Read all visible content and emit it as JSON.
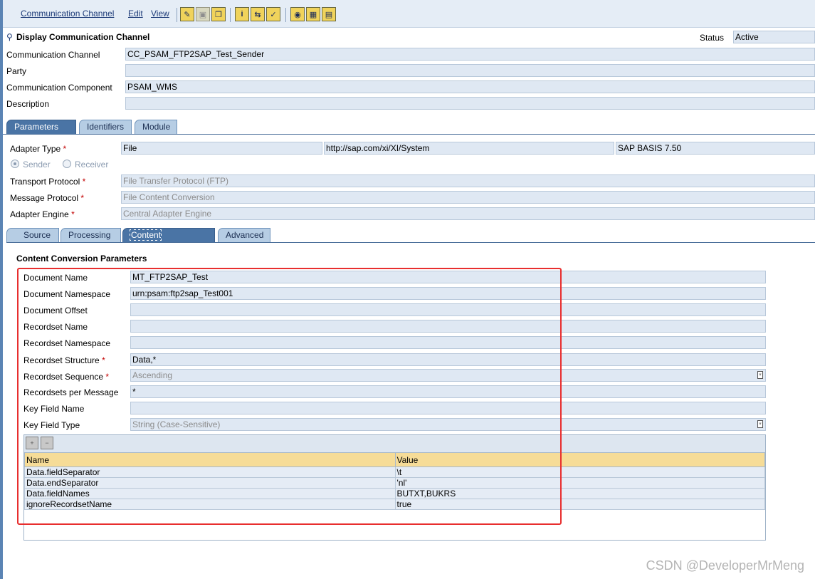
{
  "menu": {
    "items": [
      "Communication Channel",
      "Edit",
      "View"
    ]
  },
  "header": {
    "title": "Display Communication Channel",
    "status_label": "Status",
    "status_value": "Active"
  },
  "channel": {
    "fields": [
      {
        "label": "Communication Channel",
        "value": "CC_PSAM_FTP2SAP_Test_Sender"
      },
      {
        "label": "Party",
        "value": ""
      },
      {
        "label": "Communication Component",
        "value": "PSAM_WMS"
      },
      {
        "label": "Description",
        "value": ""
      }
    ]
  },
  "tabs": [
    "Parameters",
    "Identifiers",
    "Module"
  ],
  "adapter": {
    "type_label": "Adapter Type",
    "type_value": "File",
    "namespace": "http://sap.com/xi/XI/System",
    "release": "SAP BASIS 7.50",
    "sender_label": "Sender",
    "receiver_label": "Receiver",
    "transport_label": "Transport Protocol",
    "transport_value": "File Transfer Protocol (FTP)",
    "message_label": "Message Protocol",
    "message_value": "File Content Conversion",
    "engine_label": "Adapter Engine",
    "engine_value": "Central Adapter Engine"
  },
  "subtabs": [
    "Source",
    "Processing",
    "Content Conversion",
    "Advanced"
  ],
  "conversion": {
    "title": "Content Conversion Parameters",
    "fields": [
      {
        "label": "Document Name",
        "value": "MT_FTP2SAP_Test"
      },
      {
        "label": "Document Namespace",
        "value": "urn:psam:ftp2sap_Test001"
      },
      {
        "label": "Document Offset",
        "value": ""
      },
      {
        "label": "Recordset Name",
        "value": ""
      },
      {
        "label": "Recordset Namespace",
        "value": ""
      },
      {
        "label": "Recordset Structure",
        "value": "Data,*"
      },
      {
        "label": "Recordset Sequence",
        "value": "Ascending"
      },
      {
        "label": "Recordsets per Message",
        "value": "*"
      },
      {
        "label": "Key Field Name",
        "value": ""
      },
      {
        "label": "Key Field Type",
        "value": "String (Case-Sensitive)"
      }
    ],
    "table": {
      "headers": [
        "Name",
        "Value"
      ],
      "rows": [
        [
          "Data.fieldSeparator",
          "\\t"
        ],
        [
          "Data.endSeparator",
          "'nl'"
        ],
        [
          "Data.fieldNames",
          "BUTXT,BUKRS"
        ],
        [
          "ignoreRecordsetName",
          "true"
        ]
      ]
    }
  },
  "watermark": "CSDN @DeveloperMrMeng",
  "colors": {
    "field_bg": "#dfe8f3",
    "tab_active": "#4a74a5",
    "table_header": "#f6dc97",
    "highlight": "#e82e2e"
  }
}
